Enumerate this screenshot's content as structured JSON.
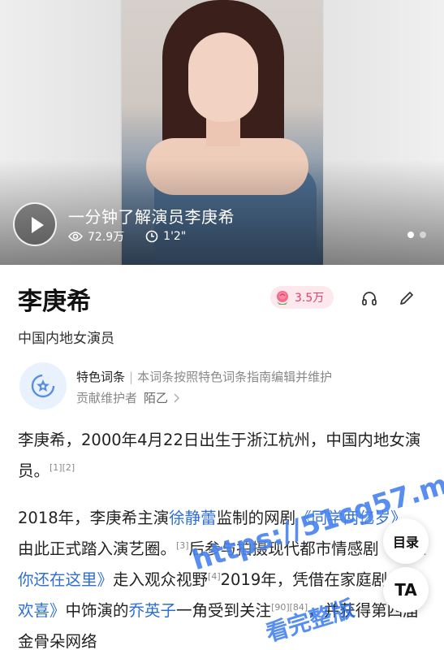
{
  "video": {
    "title": "一分钟了解演员李庚希",
    "views": "72.9万",
    "duration": "1'2\""
  },
  "entry": {
    "title": "李庚希",
    "likes": "3.5万",
    "subtitle": "中国内地女演员"
  },
  "featured": {
    "tag": "特色词条",
    "desc": "本词条按照特色词条指南编辑并维护",
    "maintainer_label": "贡献维护者",
    "maintainer_name": "陌乙"
  },
  "paragraphs": {
    "p1_text": "李庚希，2000年4月22日出生于浙江杭州，中国内地女演员。",
    "p1_ref": "[1][2]",
    "p2": {
      "t1": "2018年，李庚希主演",
      "link1": "徐静蕾",
      "t2": "监制的网剧",
      "link2": "《同学两亿岁》",
      "t3": "，由此正式踏入演艺圈。",
      "ref1": "[3]",
      "t4": "后参与拍摄现代都市情感剧",
      "link3": "《原来你还在这里》",
      "t5": "走入观众视野",
      "ref2": "[4]",
      "t6": "2019年，凭借在家庭剧",
      "link4": "《小欢喜》",
      "t7": "中饰演的",
      "link5": "乔英子",
      "t8": "一角受到关注",
      "ref3": "[90][84]",
      "t9": "，并获得第四届金骨朵网络"
    }
  },
  "fab": {
    "toc": "目录",
    "ta": "TA"
  },
  "watermark": {
    "line1": "https://51cg57.me",
    "line2": "看完整版"
  },
  "colors": {
    "link": "#2e6fd1",
    "like": "#e0406a",
    "like_bg": "#fde8ee"
  }
}
